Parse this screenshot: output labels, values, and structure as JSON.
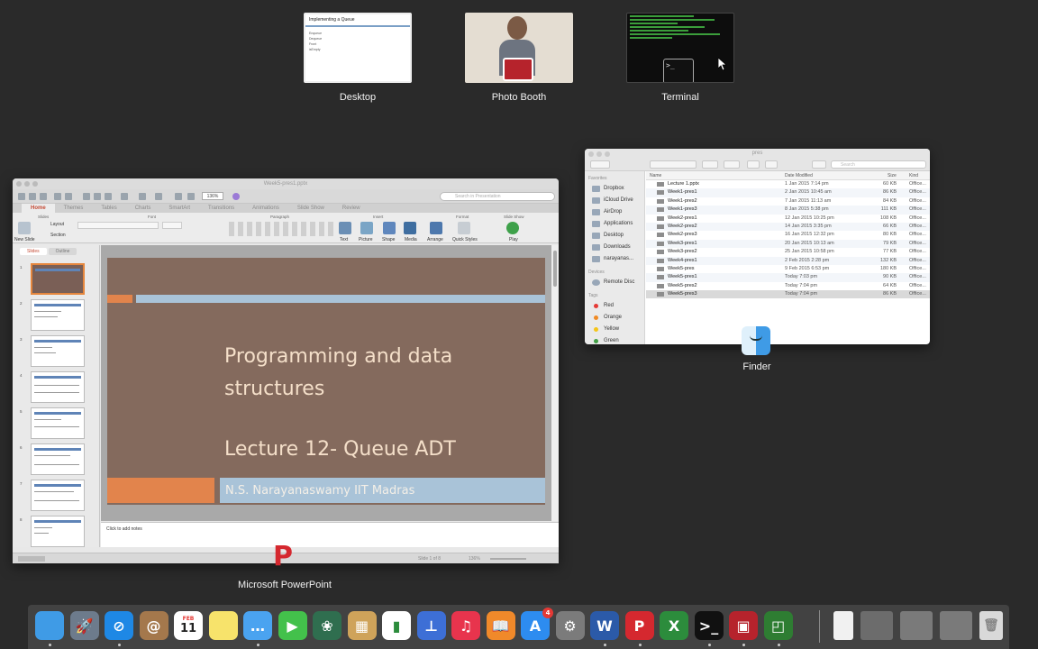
{
  "spaces": [
    {
      "label": "Desktop",
      "thumb_title": "Implementing a Queue",
      "thumb_lines": [
        "Enqueue",
        "Dequeue",
        "Front",
        "isEmpty"
      ]
    },
    {
      "label": "Photo Booth"
    },
    {
      "label": "Terminal"
    }
  ],
  "powerpoint": {
    "window_title": "Week5-pres1.pptx",
    "app_label": "Microsoft PowerPoint",
    "zoom": "136%",
    "search_placeholder": "Search in Presentation",
    "tabs": [
      "Home",
      "Themes",
      "Tables",
      "Charts",
      "SmartArt",
      "Transitions",
      "Animations",
      "Slide Show",
      "Review"
    ],
    "ribbon_groups": [
      "Slides",
      "Font",
      "Paragraph",
      "Insert",
      "Format",
      "Slide Show"
    ],
    "ribbon_buttons": [
      "New Slide",
      "Layout",
      "Section",
      "Text",
      "Picture",
      "Shape",
      "Media",
      "Arrange",
      "Quick Styles",
      "Play"
    ],
    "pane_tabs": [
      "Slides",
      "Outline"
    ],
    "slide_numbers": [
      "1",
      "2",
      "3",
      "4",
      "5",
      "6",
      "7",
      "8"
    ],
    "slide": {
      "title": "Programming and data structures",
      "subtitle": "Lecture 12- Queue ADT",
      "author": "N.S. Narayanaswamy IIT Madras"
    },
    "notes_placeholder": "Click to add notes",
    "status": {
      "slide": "Slide 1 of 8",
      "zoom": "136%"
    }
  },
  "finder": {
    "title": "pres",
    "app_label": "Finder",
    "search_placeholder": "Search",
    "sidebar": {
      "favorites_label": "Favorites",
      "favorites": [
        "Dropbox",
        "iCloud Drive",
        "AirDrop",
        "Applications",
        "Desktop",
        "Downloads",
        "narayanas..."
      ],
      "devices_label": "Devices",
      "devices": [
        "Remote Disc"
      ],
      "tags_label": "Tags",
      "tags": [
        {
          "name": "Red",
          "color": "#e53935"
        },
        {
          "name": "Orange",
          "color": "#f08a24"
        },
        {
          "name": "Yellow",
          "color": "#f5c518"
        },
        {
          "name": "Green",
          "color": "#43a047"
        }
      ]
    },
    "columns": [
      "Name",
      "Date Modified",
      "Size",
      "Kind"
    ],
    "files": [
      {
        "name": "Lecture 1.pptx",
        "date": "1 Jan 2015 7:14 pm",
        "size": "60 KB",
        "kind": "Office..."
      },
      {
        "name": "Week1-pres1",
        "date": "2 Jan 2015 10:45 am",
        "size": "86 KB",
        "kind": "Office..."
      },
      {
        "name": "Week1-pres2",
        "date": "7 Jan 2015 11:13 am",
        "size": "84 KB",
        "kind": "Office..."
      },
      {
        "name": "Week1-pres3",
        "date": "8 Jan 2015 5:38 pm",
        "size": "111 KB",
        "kind": "Office..."
      },
      {
        "name": "Week2-pres1",
        "date": "12 Jan 2015 10:25 pm",
        "size": "108 KB",
        "kind": "Office..."
      },
      {
        "name": "Week2-pres2",
        "date": "14 Jan 2015 3:35 pm",
        "size": "66 KB",
        "kind": "Office..."
      },
      {
        "name": "Week2-pres3",
        "date": "16 Jan 2015 12:32 pm",
        "size": "80 KB",
        "kind": "Office..."
      },
      {
        "name": "Week3-pres1",
        "date": "20 Jan 2015 10:13 am",
        "size": "79 KB",
        "kind": "Office..."
      },
      {
        "name": "Week3-pres2",
        "date": "25 Jan 2015 10:58 pm",
        "size": "77 KB",
        "kind": "Office..."
      },
      {
        "name": "Week4-pres1",
        "date": "2 Feb 2015 2:28 pm",
        "size": "132 KB",
        "kind": "Office..."
      },
      {
        "name": "Week5-pres",
        "date": "9 Feb 2015 6:53 pm",
        "size": "180 KB",
        "kind": "Office..."
      },
      {
        "name": "Week5-pres1",
        "date": "Today 7:03 pm",
        "size": "90 KB",
        "kind": "Office..."
      },
      {
        "name": "Week5-pres2",
        "date": "Today 7:04 pm",
        "size": "64 KB",
        "kind": "Office..."
      },
      {
        "name": "Week5-pres3",
        "date": "Today 7:04 pm",
        "size": "86 KB",
        "kind": "Office..."
      }
    ]
  },
  "dock": {
    "calendar_month": "FEB",
    "calendar_day": "11",
    "appstore_badge": "4",
    "items": [
      {
        "name": "Finder",
        "color": "#3f9be6",
        "glyph": ""
      },
      {
        "name": "Launchpad",
        "color": "#6d7b8c",
        "glyph": "🚀"
      },
      {
        "name": "Safari",
        "color": "#1e88e5",
        "glyph": "⊘"
      },
      {
        "name": "Contacts",
        "color": "#a4784c",
        "glyph": "@"
      },
      {
        "name": "Calendar",
        "color": "#ffffff",
        "glyph": ""
      },
      {
        "name": "Notes",
        "color": "#f7e36b",
        "glyph": ""
      },
      {
        "name": "Messages",
        "color": "#4aa3f0",
        "glyph": "…"
      },
      {
        "name": "FaceTime",
        "color": "#43c14b",
        "glyph": "▶"
      },
      {
        "name": "Photos",
        "color": "#2f6e4f",
        "glyph": "❀"
      },
      {
        "name": "Preview",
        "color": "#cfa35a",
        "glyph": "▦"
      },
      {
        "name": "Numbers",
        "color": "#ffffff",
        "glyph": "▮"
      },
      {
        "name": "Keynote",
        "color": "#3d6fd6",
        "glyph": "⊥"
      },
      {
        "name": "iTunes",
        "color": "#e8344d",
        "glyph": "♫"
      },
      {
        "name": "iBooks",
        "color": "#f0892a",
        "glyph": "📖"
      },
      {
        "name": "App Store",
        "color": "#2d8cf0",
        "glyph": "A"
      },
      {
        "name": "System Preferences",
        "color": "#7b7b7b",
        "glyph": "⚙"
      },
      {
        "name": "Microsoft Word",
        "color": "#2b5aa8",
        "glyph": "W"
      },
      {
        "name": "Microsoft PowerPoint",
        "color": "#d5282f",
        "glyph": "P"
      },
      {
        "name": "Microsoft Excel",
        "color": "#2c8c3c",
        "glyph": "X"
      },
      {
        "name": "Terminal",
        "color": "#111111",
        "glyph": ">_"
      },
      {
        "name": "Photo Booth",
        "color": "#b6232c",
        "glyph": "▣"
      },
      {
        "name": "Camtasia",
        "color": "#2e7d32",
        "glyph": "◰"
      }
    ],
    "right_items": [
      "Document",
      "PowerPoint window",
      "PowerPoint window",
      "PowerPoint window",
      "Trash"
    ]
  }
}
